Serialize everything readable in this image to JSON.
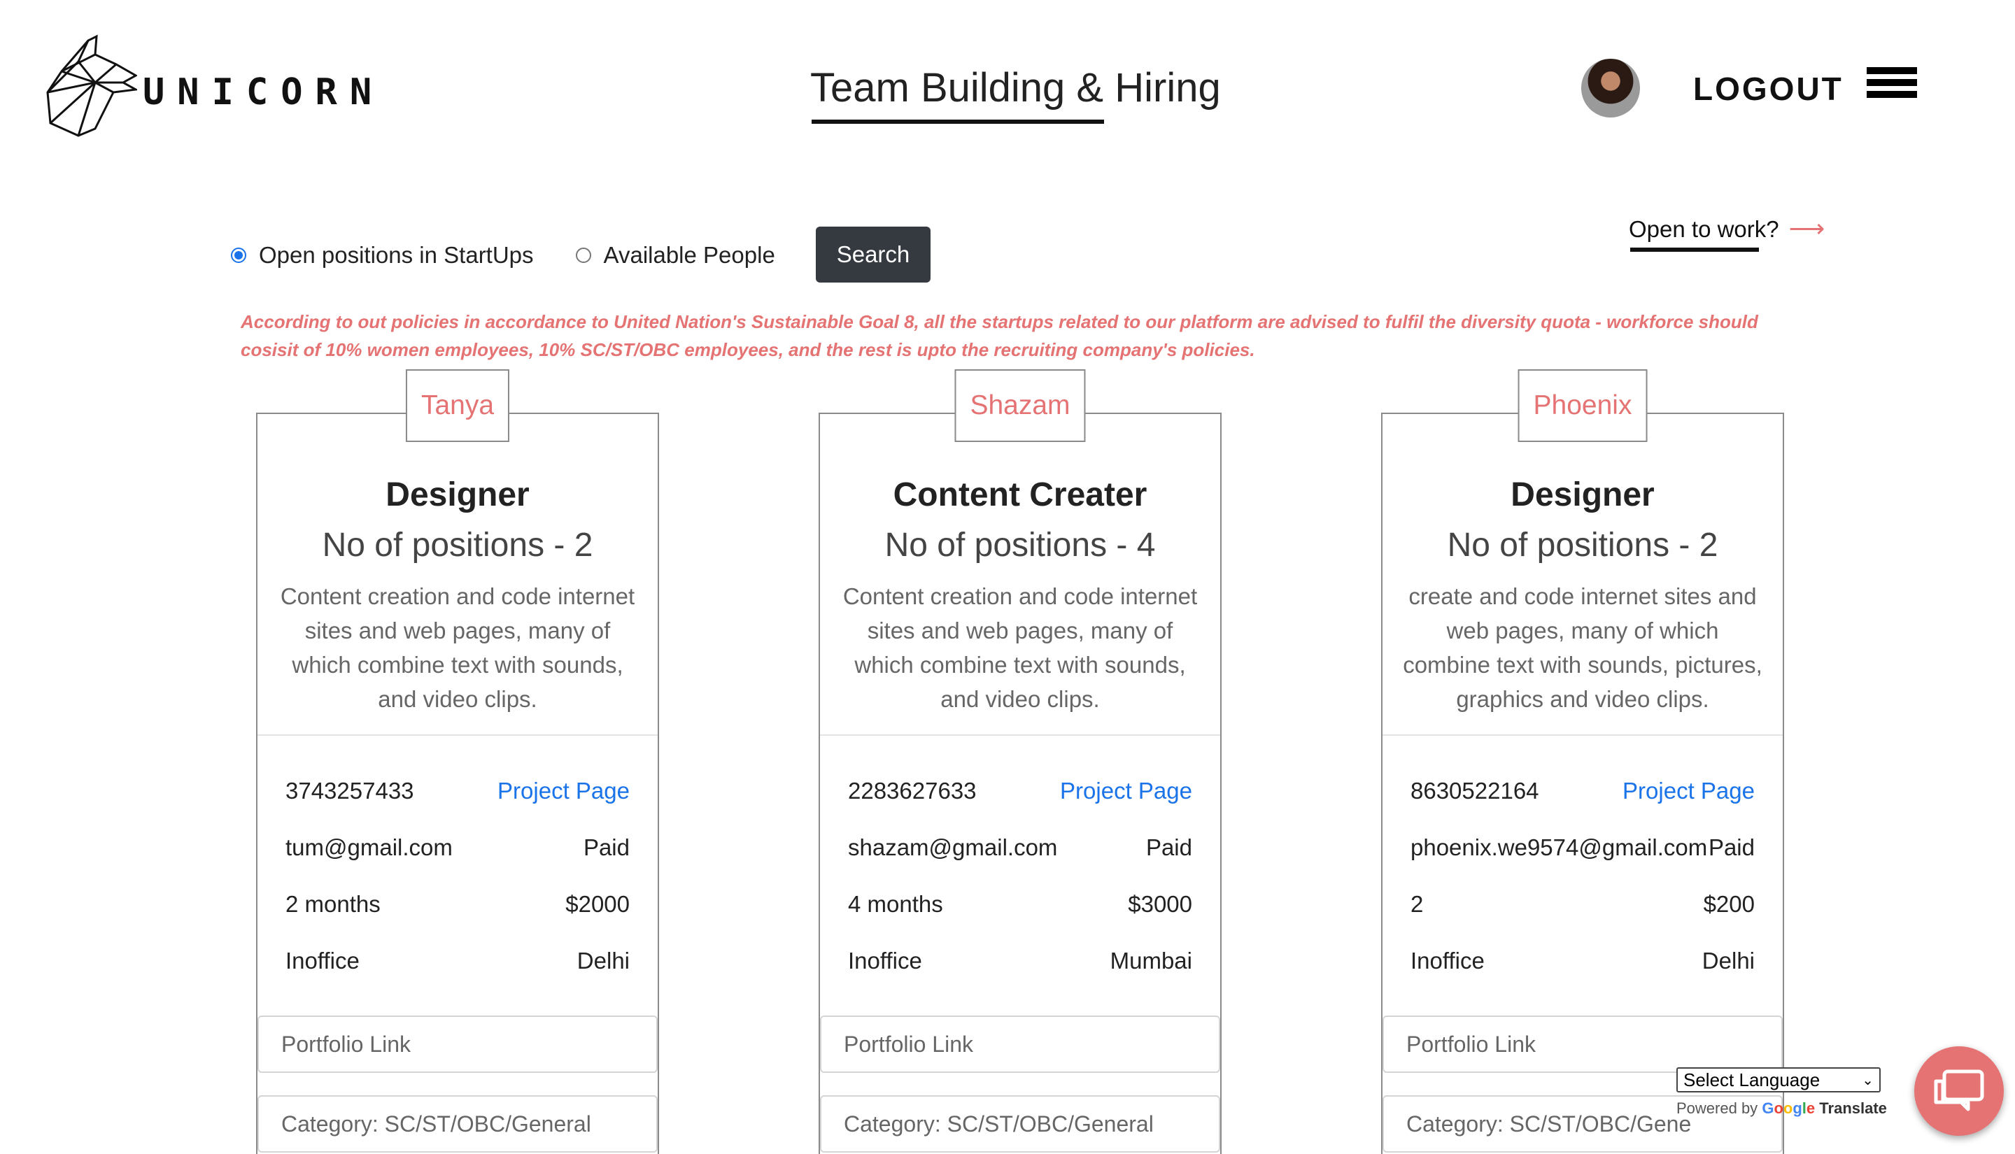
{
  "header": {
    "logo_text": "UNICORN",
    "page_title": "Team Building & Hiring",
    "logout_label": "LOGOUT"
  },
  "search": {
    "option_startups": "Open positions in StartUps",
    "option_people": "Available People",
    "selected": "Open positions in StartUps",
    "button_label": "Search",
    "open_to_work": "Open to work?"
  },
  "policy_text": "According to out policies in accordance to United Nation's Sustainable Goal 8, all the startups related to our platform are advised to fulfil the diversity quota - workforce should cosisit of 10% women employees, 10% SC/ST/OBC employees, and the rest is upto the recruiting company's policies.",
  "cards": [
    {
      "name": "Tanya",
      "role": "Designer",
      "positions": "No of positions - 2",
      "description": "Content creation and code internet sites and web pages, many of which combine text with sounds, and video clips.",
      "phone": "3743257433",
      "project_link": "Project Page",
      "email": "tum@gmail.com",
      "pay_type": "Paid",
      "duration": "2 months",
      "stipend": "$2000",
      "mode": "Inoffice",
      "location": "Delhi",
      "portfolio_placeholder": "Portfolio Link",
      "category_placeholder": "Category: SC/ST/OBC/General"
    },
    {
      "name": "Shazam",
      "role": "Content Creater",
      "positions": "No of positions - 4",
      "description": "Content creation and code internet sites and web pages, many of which combine text with sounds, and video clips.",
      "phone": "2283627633",
      "project_link": "Project Page",
      "email": "shazam@gmail.com",
      "pay_type": "Paid",
      "duration": "4 months",
      "stipend": "$3000",
      "mode": "Inoffice",
      "location": "Mumbai",
      "portfolio_placeholder": "Portfolio Link",
      "category_placeholder": "Category: SC/ST/OBC/General"
    },
    {
      "name": "Phoenix",
      "role": "Designer",
      "positions": "No of positions - 2",
      "description": "create and code internet sites and web pages, many of which combine text with sounds, pictures, graphics and video clips.",
      "phone": "8630522164",
      "project_link": "Project Page",
      "email": "phoenix.we9574@gmail.com",
      "pay_type": "Paid",
      "duration": "2",
      "stipend": "$200",
      "mode": "Inoffice",
      "location": "Delhi",
      "portfolio_placeholder": "Portfolio Link",
      "category_placeholder": "Category: SC/ST/OBC/Gene"
    }
  ],
  "translate": {
    "select_label": "Select Language",
    "powered_by": "Powered by",
    "google": "Google",
    "translate": "Translate"
  },
  "colors": {
    "accent": "#e57373",
    "link": "#1a73e8",
    "button": "#343a40"
  }
}
